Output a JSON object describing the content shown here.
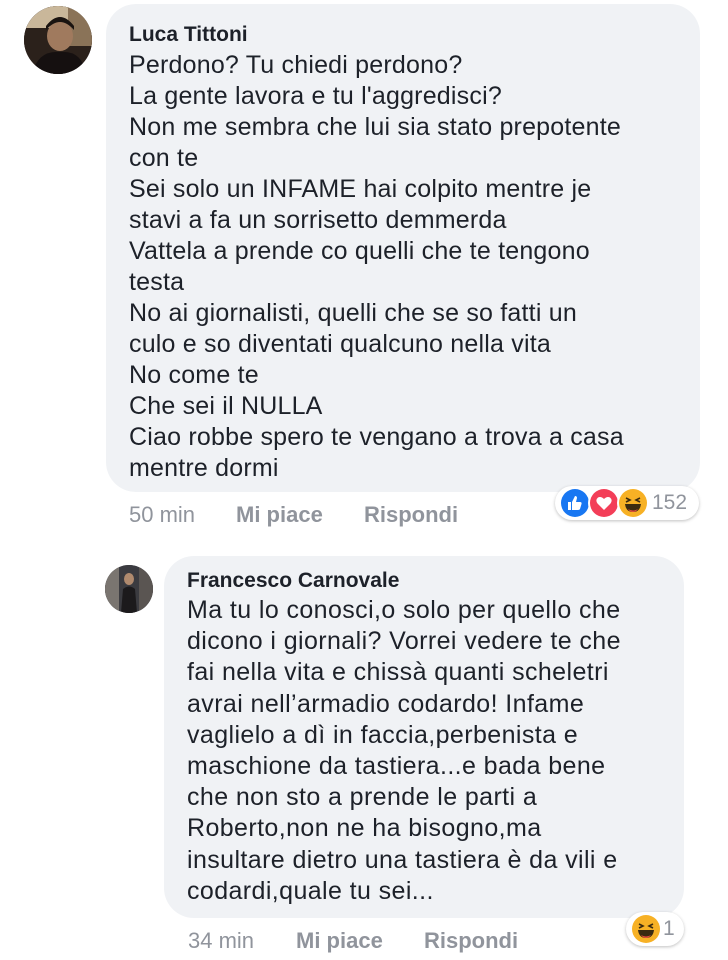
{
  "comments": [
    {
      "author": "Luca Tittoni",
      "text": "Perdono? Tu chiedi perdono?\nLa gente lavora e tu l'aggredisci?\nNon me sembra che lui sia stato prepotente\ncon te\nSei solo un INFAME hai colpito mentre je\nstavi a fa un sorrisetto demmerda\nVattela a prende co quelli che te tengono\ntesta\nNo ai giornalisti, quelli che se so fatti un\nculo e so diventati qualcuno nella vita\nNo come te\nChe sei il NULLA\nCiao robbe spero te vengano a trova a casa\nmentre dormi",
      "time": "50 min",
      "like_label": "Mi piace",
      "reply_label": "Rispondi",
      "reactions": [
        "like-icon",
        "love-icon",
        "haha-icon"
      ],
      "reaction_count": "152"
    },
    {
      "author": "Francesco Carnovale",
      "text": "Ma tu lo conosci,o solo per quello che\ndicono i giornali? Vorrei vedere te che\nfai nella vita e chissà quanti scheletri\navrai nell’armadio codardo! Infame\nvaglielo a dì in faccia,perbenista e\nmaschione da tastiera...e bada bene\nche non sto a prende le parti a\nRoberto,non ne ha bisogno,ma\ninsultare dietro una tastiera è da vili e\ncodardi,quale tu sei...",
      "time": "34 min",
      "like_label": "Mi piace",
      "reply_label": "Rispondi",
      "reactions": [
        "haha-icon"
      ],
      "reaction_count": "1"
    }
  ],
  "colors": {
    "bubble": "#f0f2f5",
    "meta_text": "#90949c",
    "like": "#1877f2",
    "love": "#f33e58",
    "haha": "#f7b125"
  }
}
